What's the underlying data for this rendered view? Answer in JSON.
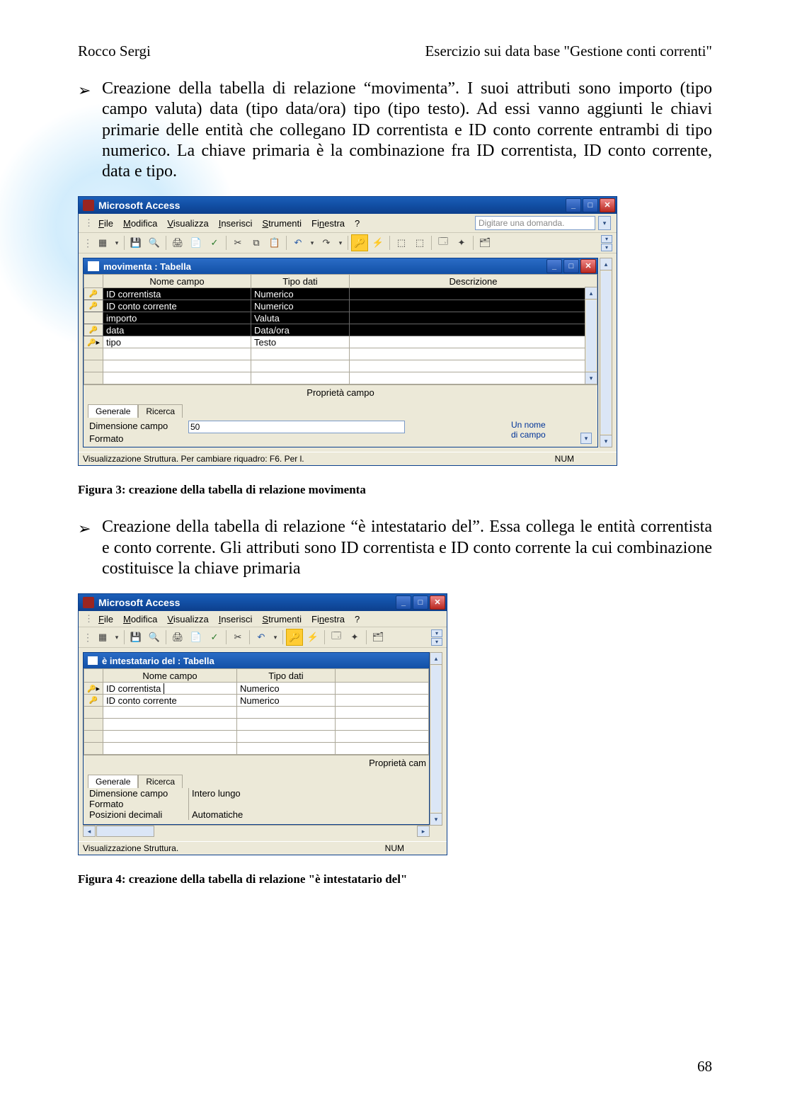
{
  "header": {
    "left": "Rocco Sergi",
    "right": "Esercizio sui data base \"Gestione conti correnti\""
  },
  "bullet1": "Creazione della tabella di relazione “movimenta”. I suoi attributi sono importo (tipo campo valuta) data (tipo data/ora) tipo (tipo testo). Ad essi vanno aggiunti le chiavi primarie delle entità che collegano ID correntista e ID conto corrente entrambi di tipo numerico. La chiave primaria è la combinazione fra ID correntista, ID conto corrente, data e tipo.",
  "caption1": "Figura 3: creazione della tabella di relazione movimenta",
  "bullet2": "Creazione della tabella di relazione  “è intestatario del”. Essa collega le entità correntista e conto corrente. Gli attributi sono ID correntista e ID conto corrente la cui combinazione costituisce la chiave primaria",
  "caption2": "Figura 4: creazione della tabella di relazione \"è intestatario del\"",
  "page_number": "68",
  "access_common": {
    "app_title": "Microsoft Access",
    "menu": {
      "file": "File",
      "modifica": "Modifica",
      "visualizza": "Visualizza",
      "inserisci": "Inserisci",
      "strumenti": "Strumenti",
      "finestra": "Finestra",
      "help": "?"
    },
    "ask_placeholder": "Digitare una domanda.",
    "headers": {
      "nome_campo": "Nome campo",
      "tipo_dati": "Tipo dati",
      "descrizione": "Descrizione"
    },
    "proprieta_campo": "Proprietà campo",
    "tabs": {
      "generale": "Generale",
      "ricerca": "Ricerca"
    },
    "num": "NUM"
  },
  "screenshot1": {
    "mdi_title": "movimenta : Tabella",
    "rows": [
      {
        "key": true,
        "sel": true,
        "name": "ID correntista",
        "type": "Numerico"
      },
      {
        "key": true,
        "sel": true,
        "name": "ID conto corrente",
        "type": "Numerico"
      },
      {
        "key": false,
        "sel": true,
        "name": "importo",
        "type": "Valuta"
      },
      {
        "key": true,
        "sel": true,
        "name": "data",
        "type": "Data/ora"
      },
      {
        "key": true,
        "sel": false,
        "cursor": true,
        "name": "tipo",
        "type": "Testo"
      }
    ],
    "prop_label": "Dimensione campo",
    "prop_value": "50",
    "prop_label2": "Formato",
    "hint1": "Un nome",
    "hint2": "di campo",
    "status": "Visualizzazione Struttura. Per cambiare riquadro: F6. Per l."
  },
  "screenshot2": {
    "mdi_title": "è intestatario del : Tabella",
    "rows": [
      {
        "key": true,
        "cursor": true,
        "name": "ID correntista",
        "type": "Numerico"
      },
      {
        "key": true,
        "name": "ID conto corrente",
        "type": "Numerico"
      }
    ],
    "prop_cam": "Proprietà cam",
    "props": [
      {
        "label": "Dimensione campo",
        "value": "Intero lungo"
      },
      {
        "label": "Formato",
        "value": ""
      },
      {
        "label": "Posizioni decimali",
        "value": "Automatiche"
      }
    ],
    "status": "Visualizzazione Struttura."
  }
}
